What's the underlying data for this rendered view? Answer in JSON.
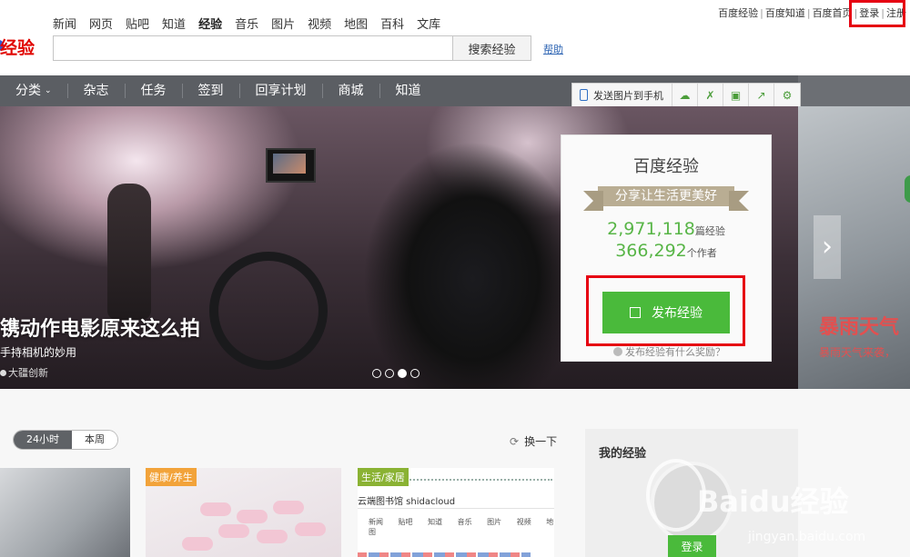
{
  "top_links": {
    "jingyan": "百度经验",
    "zhidao": "百度知道",
    "home": "百度首页",
    "login": "登录",
    "register": "注册"
  },
  "logo": {
    "text": "经验"
  },
  "nav_tabs": [
    "新闻",
    "网页",
    "贴吧",
    "知道",
    "经验",
    "音乐",
    "图片",
    "视频",
    "地图",
    "百科",
    "文库"
  ],
  "search": {
    "value": "",
    "button": "搜索经验",
    "help": "帮助"
  },
  "navbar": {
    "items": [
      "分类",
      "杂志",
      "任务",
      "签到",
      "回享计划",
      "商城",
      "知道"
    ]
  },
  "toolbar": {
    "send": "发送图片到手机",
    "icons": [
      "cloud-icon",
      "expand-icon",
      "save-icon",
      "share-icon",
      "gear-icon"
    ]
  },
  "hero": {
    "title": "镌动作电影原来这么拍",
    "subtitle": "手持相机的妙用",
    "author": "大疆创新",
    "slides": 4,
    "active_slide": 3
  },
  "stats": {
    "title": "百度经验",
    "slogan": "分享让生活更美好",
    "experiences": "2,971,118",
    "experiences_unit": "篇经验",
    "authors": "366,292",
    "authors_unit": "个作者",
    "publish": "发布经验",
    "reward": "发布经验有什么奖励？"
  },
  "next_slide": {
    "title": "暴雨天气",
    "subtitle": "暴雨天气来袭，"
  },
  "feed": {
    "tabs": [
      "24小时",
      "本周"
    ],
    "refresh": "换一下",
    "cards": [
      {
        "tag": ""
      },
      {
        "tag": "健康/养生"
      },
      {
        "tag": "生活/家居",
        "site": "云端图书馆 shidacloud",
        "mini_tabs": "新闻 贴吧 知道 音乐 图片 视频 地图"
      }
    ]
  },
  "my_panel": {
    "title": "我的经验",
    "login": "登录"
  },
  "watermark": {
    "brand": "Baidu经验",
    "url": "jingyan.baidu.com"
  },
  "colors": {
    "accent_green": "#4aba3b",
    "nav_gray": "#5b5e63",
    "highlight_red": "#e60012"
  }
}
